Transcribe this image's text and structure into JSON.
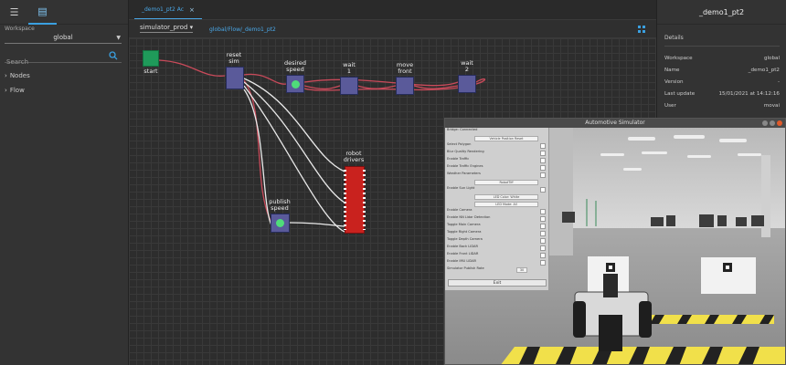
{
  "sidebar": {
    "tab_menu_icon": "menu-icon",
    "tab_list_icon": "list-icon",
    "workspace_label": "Workspace",
    "workspace_value": "global",
    "search_placeholder": "Search",
    "tree": [
      {
        "label": "Nodes"
      },
      {
        "label": "Flow"
      }
    ]
  },
  "editor": {
    "tab_label": "_demo1_pt2 Ac",
    "tab_close": "×",
    "simulator_select": "simulator_prod",
    "flow_path": "global/Flow/_demo1_pt2",
    "nodes": {
      "start": "start",
      "reset_sim_1": "reset",
      "reset_sim_2": "sim",
      "desired_speed_1": "desired",
      "desired_speed_2": "speed",
      "wait1_1": "wait",
      "wait1_2": "1",
      "move_front_1": "move",
      "move_front_2": "front",
      "wait2_1": "wait",
      "wait2_2": "2",
      "publish_speed_1": "publish",
      "publish_speed_2": "speed",
      "robot_drivers_1": "robot",
      "robot_drivers_2": "drivers"
    }
  },
  "details": {
    "panel_title": "_demo1_pt2",
    "section_title": "Details",
    "rows": [
      {
        "key": "Workspace",
        "value": "global"
      },
      {
        "key": "Name",
        "value": "_demo1_pt2"
      },
      {
        "key": "Version",
        "value": "-"
      },
      {
        "key": "Last update",
        "value": "15/01/2021 at 14:12:16"
      },
      {
        "key": "User",
        "value": "movai"
      }
    ]
  },
  "simulator": {
    "title": "Automotive Simulator",
    "options": [
      {
        "label": "Bridge: Connected",
        "field": ""
      },
      {
        "label": "",
        "field": "Vehicle Position Reset"
      },
      {
        "label": "Select Polygon",
        "field": ""
      },
      {
        "label": "Blur Quality Rendering",
        "field": ""
      },
      {
        "label": "Enable Traffic",
        "field": ""
      },
      {
        "label": "Enable Traffic Engines",
        "field": ""
      },
      {
        "label": "Weather Parameters",
        "field": ""
      },
      {
        "label": "",
        "field": "RobotTiff"
      },
      {
        "label": "Enable Sun Light",
        "field": ""
      },
      {
        "label": "",
        "field": "LED Color: White"
      },
      {
        "label": "",
        "field": "LED Mode: All"
      },
      {
        "label": "Enable Camera",
        "field": ""
      },
      {
        "label": "Enable NN Lidar Detection",
        "field": ""
      },
      {
        "label": "Toggle Main Camera",
        "field": ""
      },
      {
        "label": "Toggle Right Camera",
        "field": ""
      },
      {
        "label": "Toggle Depth Camera",
        "field": ""
      },
      {
        "label": "Enable Back LIDAR",
        "field": ""
      },
      {
        "label": "Enable Front LIDAR",
        "field": ""
      },
      {
        "label": "Enable IMU LIDAR",
        "field": ""
      },
      {
        "label": "Simulator Publish Rate",
        "field": "30"
      }
    ],
    "exit_label": "Exit"
  },
  "colors": {
    "accent": "#3aa0e0",
    "node": "#5a5a9a",
    "start_node": "#1f9a5a",
    "robot_drivers": "#c9221e",
    "link": "#c94a5a"
  }
}
